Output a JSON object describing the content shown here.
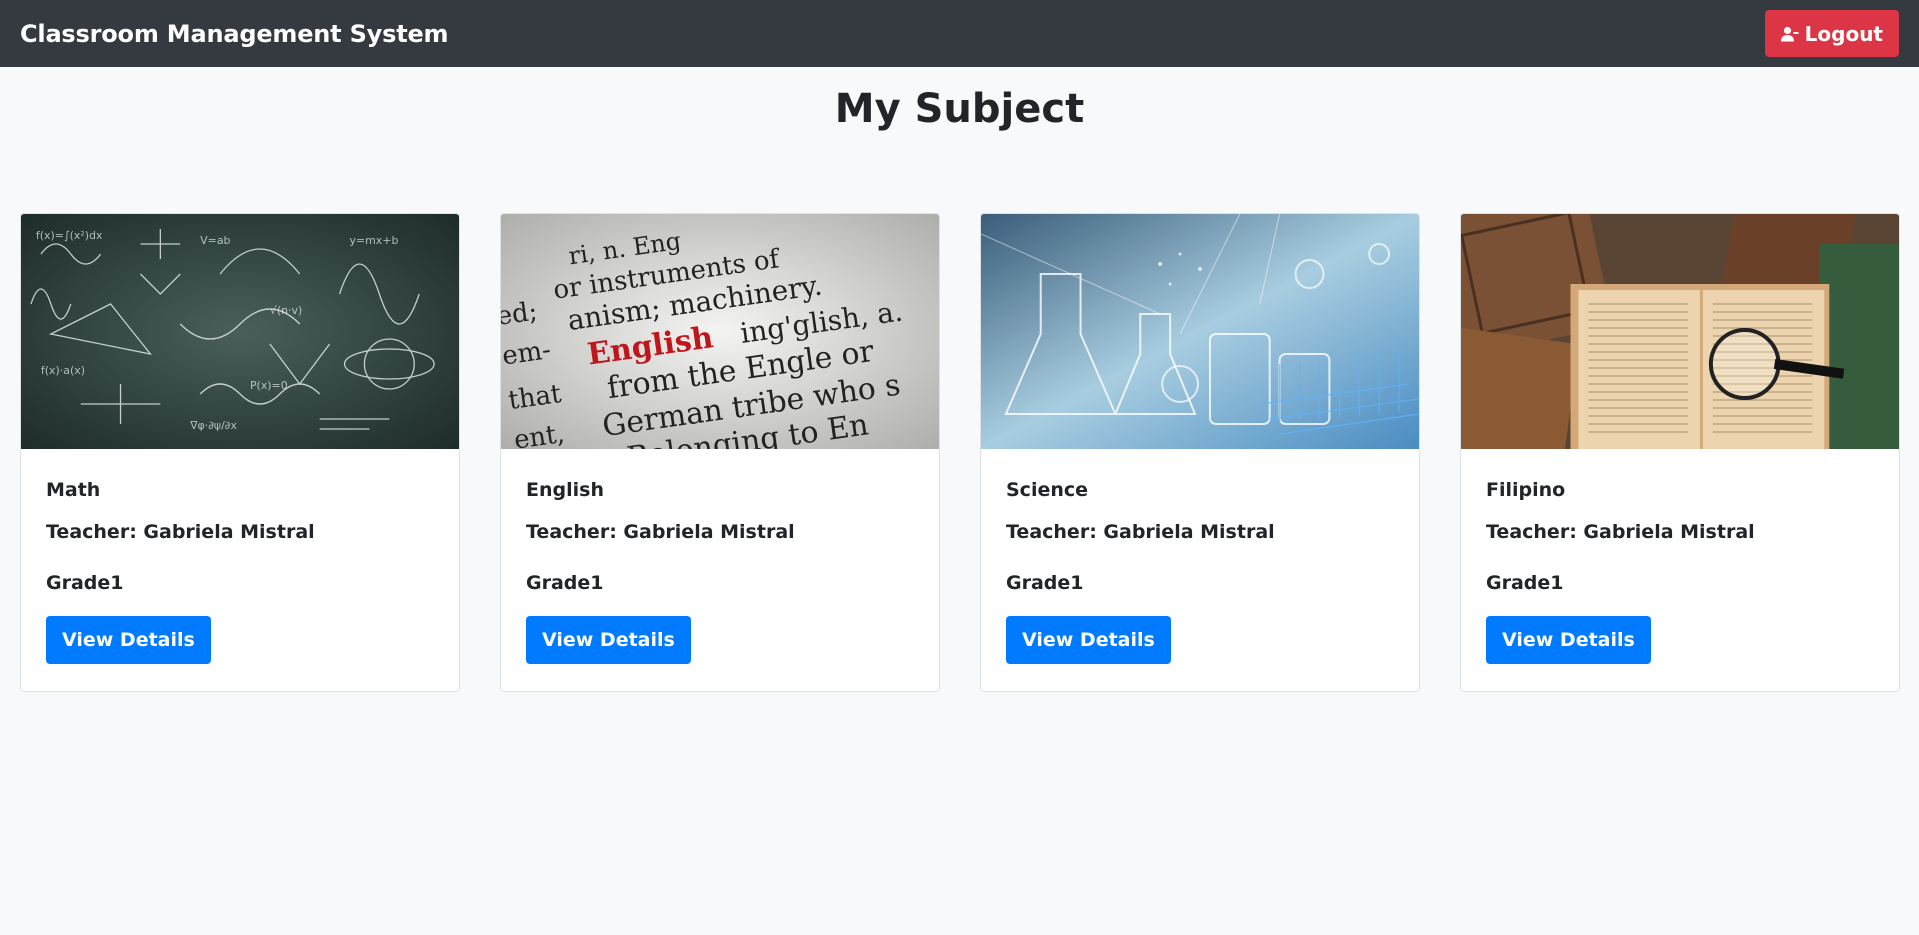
{
  "app": {
    "title": "Classroom Management System"
  },
  "navbar": {
    "logout_label": "Logout",
    "logout_icon": "user-minus-icon"
  },
  "page": {
    "title": "My Subject"
  },
  "subjects": [
    {
      "name": "Math",
      "teacher": "Teacher: Gabriela Mistral",
      "grade": "Grade1",
      "button_label": "View Details",
      "image": "math-chalkboard-image"
    },
    {
      "name": "English",
      "teacher": "Teacher: Gabriela Mistral",
      "grade": "Grade1",
      "button_label": "View Details",
      "image": "english-dictionary-image"
    },
    {
      "name": "Science",
      "teacher": "Teacher: Gabriela Mistral",
      "grade": "Grade1",
      "button_label": "View Details",
      "image": "science-lab-image"
    },
    {
      "name": "Filipino",
      "teacher": "Teacher: Gabriela Mistral",
      "grade": "Grade1",
      "button_label": "View Details",
      "image": "old-books-image"
    }
  ],
  "colors": {
    "navbar_bg": "#343a40",
    "logout_bg": "#dc3545",
    "primary_button": "#007bff",
    "page_bg": "#f8f9fa"
  }
}
